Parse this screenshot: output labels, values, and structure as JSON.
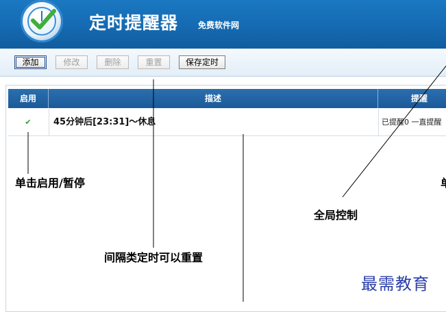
{
  "header": {
    "title": "定时提醒器",
    "subtitle": "免费软件网"
  },
  "toolbar": {
    "add": "添加",
    "edit": "修改",
    "delete": "删除",
    "reset": "重置",
    "save": "保存定时"
  },
  "table": {
    "columns": [
      "启用",
      "描述",
      "提醒"
    ],
    "rows": [
      {
        "enabled": "✔",
        "description": "45分钟后[23:31]～休息",
        "status": "已提醒0  一直提醒"
      }
    ]
  },
  "annotations": {
    "toggle": "单击启用/暂停",
    "global": "全局控制",
    "interval": "间隔类定时可以重置",
    "edge": "单"
  },
  "watermark": "最需教育"
}
